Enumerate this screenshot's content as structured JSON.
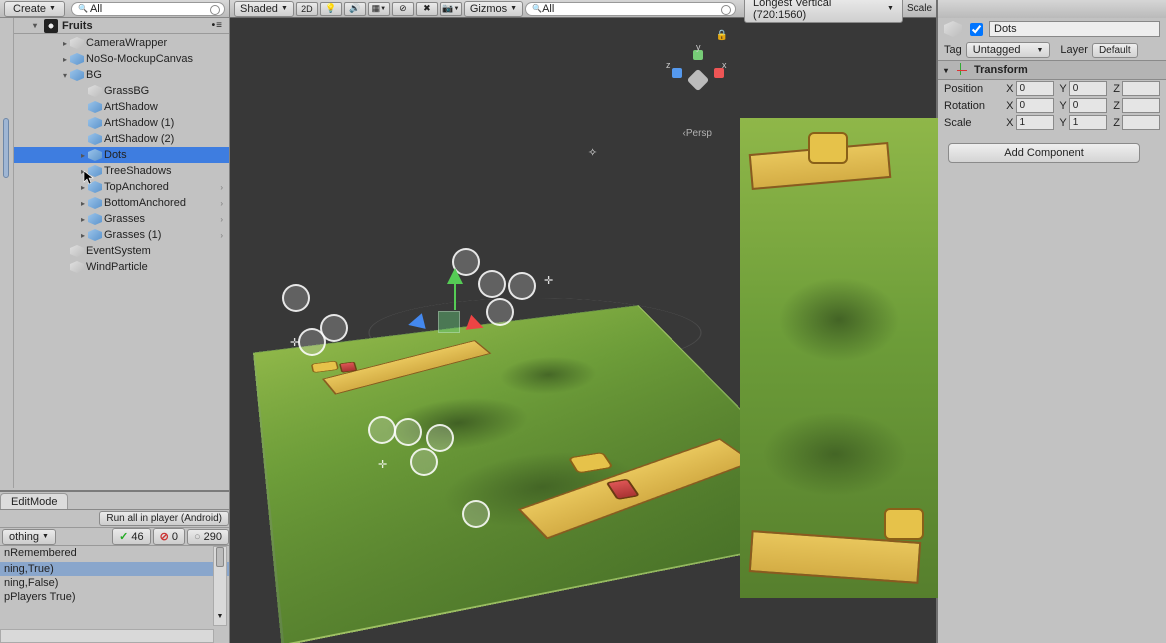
{
  "hierarchy": {
    "create": "Create",
    "search_ph": "All",
    "scene": "Fruits",
    "items": [
      {
        "label": "CameraWrapper",
        "indent": 60,
        "fold": "▸",
        "cube": "grey"
      },
      {
        "label": "NoSo-MockupCanvas",
        "indent": 60,
        "fold": "▸",
        "cube": "blue"
      },
      {
        "label": "BG",
        "indent": 60,
        "fold": "▾",
        "cube": "blue"
      },
      {
        "label": "GrassBG",
        "indent": 78,
        "fold": "",
        "cube": "grey"
      },
      {
        "label": "ArtShadow",
        "indent": 78,
        "fold": "",
        "cube": "blue"
      },
      {
        "label": "ArtShadow (1)",
        "indent": 78,
        "fold": "",
        "cube": "blue"
      },
      {
        "label": "ArtShadow (2)",
        "indent": 78,
        "fold": "",
        "cube": "blue"
      },
      {
        "label": "Dots",
        "indent": 78,
        "fold": "▸",
        "cube": "blue",
        "sel": true
      },
      {
        "label": "TreeShadows",
        "indent": 78,
        "fold": "▸",
        "cube": "blue"
      },
      {
        "label": "TopAnchored",
        "indent": 78,
        "fold": "▸",
        "cube": "blue",
        "chev": true
      },
      {
        "label": "BottomAnchored",
        "indent": 78,
        "fold": "▸",
        "cube": "blue",
        "chev": true
      },
      {
        "label": "Grasses",
        "indent": 78,
        "fold": "▸",
        "cube": "blue",
        "chev": true
      },
      {
        "label": "Grasses (1)",
        "indent": 78,
        "fold": "▸",
        "cube": "blue",
        "chev": true
      },
      {
        "label": "EventSystem",
        "indent": 60,
        "fold": "",
        "cube": "grey"
      },
      {
        "label": "WindParticle",
        "indent": 60,
        "fold": "",
        "cube": "grey"
      }
    ]
  },
  "testpanel": {
    "tab": "EditMode",
    "run": "Run all in player (Android)",
    "filter": "othing",
    "pass": "46",
    "fail": "0",
    "skip": "290",
    "lines": [
      {
        "t": "nRemembered"
      },
      {
        "t": ""
      },
      {
        "t": "ning,True)",
        "hl": true
      },
      {
        "t": "ning,False)"
      },
      {
        "t": "pPlayers True)"
      }
    ]
  },
  "scene_toolbar": {
    "shaded": "Shaded",
    "two_d": "2D",
    "gizmos": "Gizmos",
    "search_ph": "All"
  },
  "scene_view": {
    "persp": "Persp",
    "axes": {
      "x": "x",
      "y": "y",
      "z": "z"
    }
  },
  "game_toolbar": {
    "aspect": "Longest Vertical (720:1560)",
    "scale": "Scale"
  },
  "inspector": {
    "name": "Dots",
    "tag_lbl": "Tag",
    "tag_val": "Untagged",
    "layer_lbl": "Layer",
    "layer_val": "Default",
    "transform": "Transform",
    "rows": [
      {
        "lbl": "Position",
        "x": "0",
        "y": "0",
        "z": ""
      },
      {
        "lbl": "Rotation",
        "x": "0",
        "y": "0",
        "z": ""
      },
      {
        "lbl": "Scale",
        "x": "1",
        "y": "1",
        "z": ""
      }
    ],
    "add": "Add Component"
  }
}
